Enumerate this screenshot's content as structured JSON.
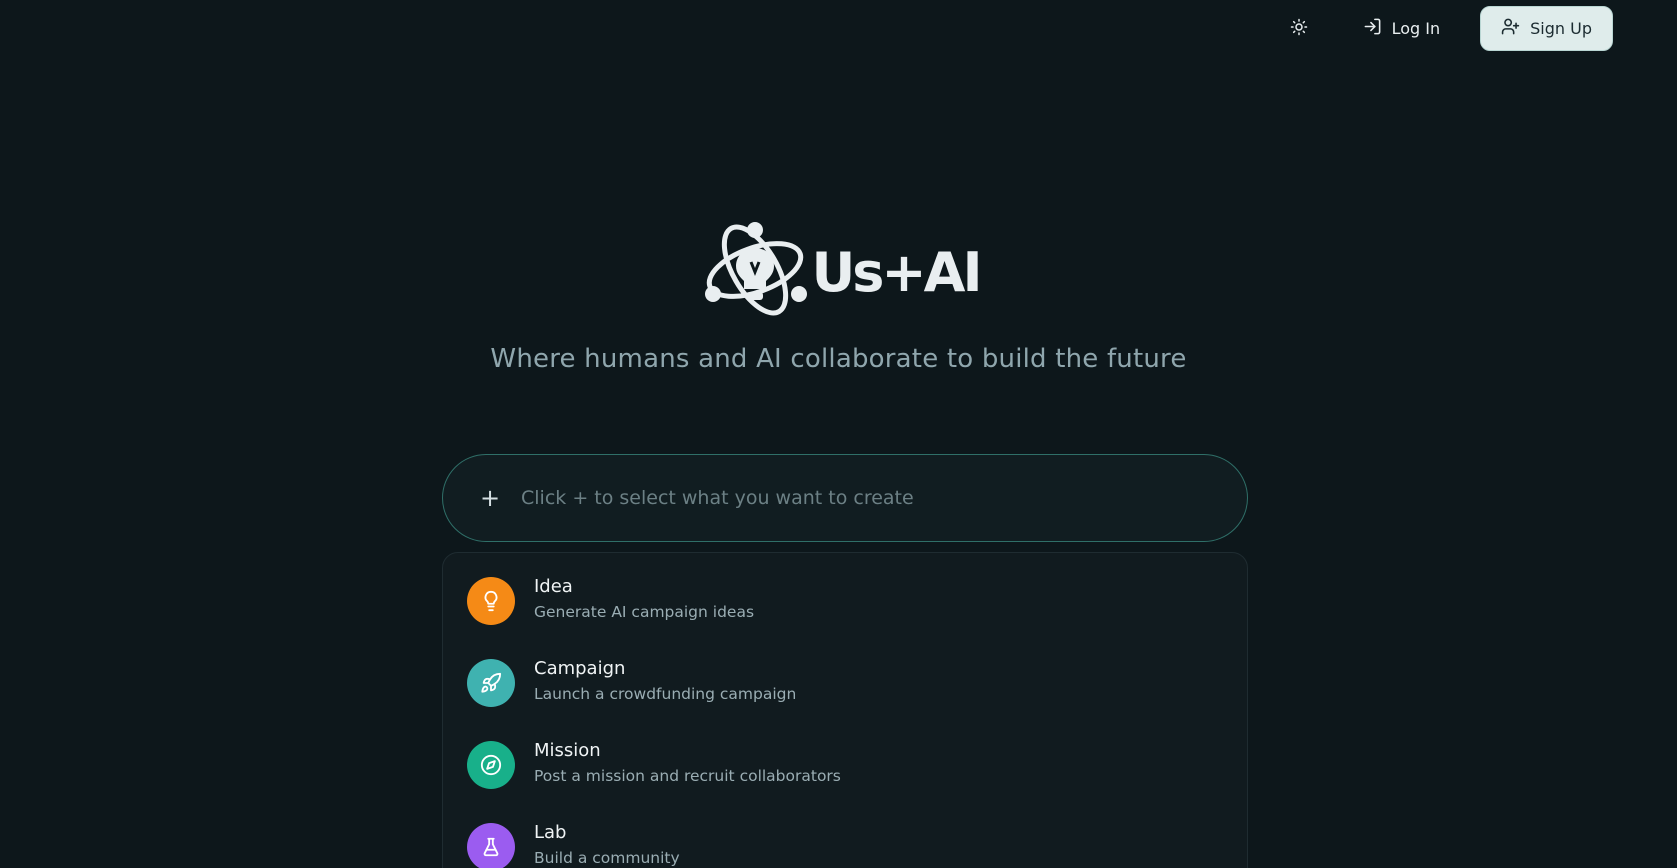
{
  "nav": {
    "theme_icon": "sun-icon",
    "login_label": "Log In",
    "signup_label": "Sign Up"
  },
  "hero": {
    "logo_text": "Us+AI",
    "tagline": "Where humans and AI collaborate to build the future"
  },
  "prompt": {
    "plus_label": "+",
    "placeholder": "Click + to select what you want to create"
  },
  "menu": {
    "items": [
      {
        "title": "Idea",
        "subtitle": "Generate AI campaign ideas",
        "icon": "lightbulb-icon",
        "color": "#f58a16"
      },
      {
        "title": "Campaign",
        "subtitle": "Launch a crowdfunding campaign",
        "icon": "rocket-icon",
        "color": "#3fb2b0"
      },
      {
        "title": "Mission",
        "subtitle": "Post a mission and recruit collaborators",
        "icon": "compass-icon",
        "color": "#18b08a"
      },
      {
        "title": "Lab",
        "subtitle": "Build a community",
        "icon": "flask-icon",
        "color": "#9b5cf0"
      }
    ]
  },
  "colors": {
    "background": "#0d171b",
    "accent_border": "#2f6f68",
    "signup_bg": "#dfeceb"
  }
}
